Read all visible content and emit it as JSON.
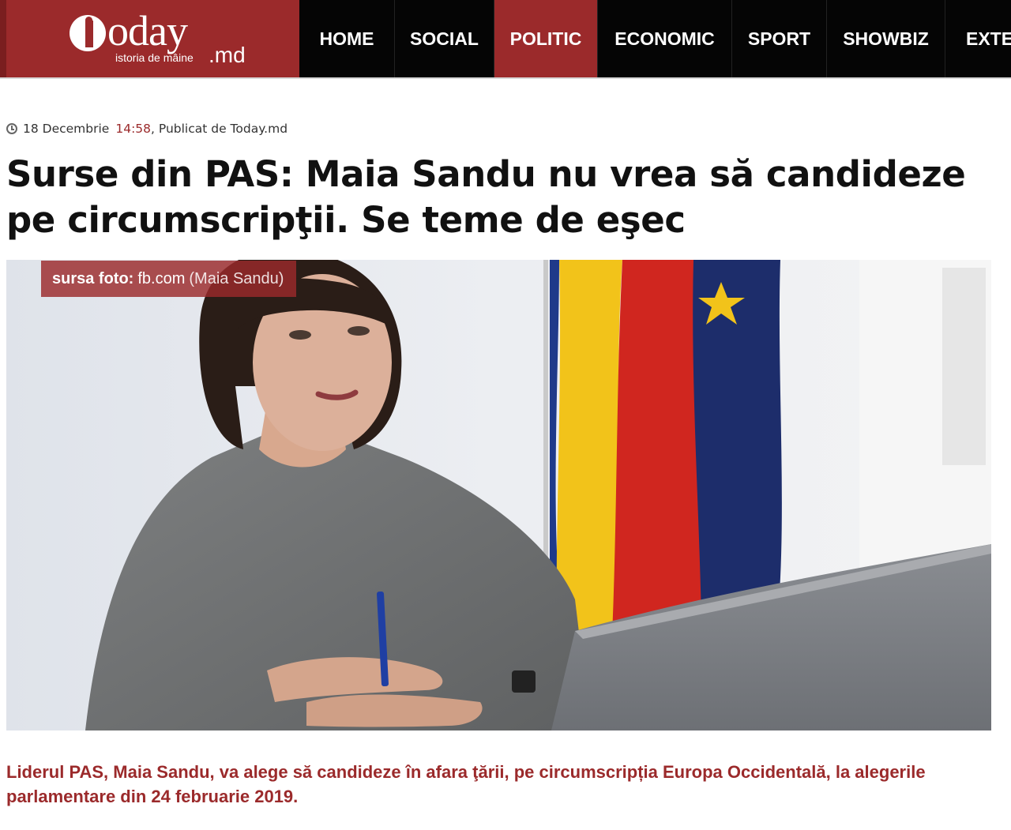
{
  "site": {
    "logo_text": "today",
    "logo_tagline": "istoria de mâine",
    "logo_tld": ".md"
  },
  "nav": {
    "items": [
      {
        "label": "HOME",
        "active": false
      },
      {
        "label": "SOCIAL",
        "active": false
      },
      {
        "label": "POLITIC",
        "active": true
      },
      {
        "label": "ECONOMIC",
        "active": false
      },
      {
        "label": "SPORT",
        "active": false
      },
      {
        "label": "SHOWBIZ",
        "active": false
      },
      {
        "label": "EXTER",
        "active": false
      }
    ]
  },
  "article": {
    "date": "18 Decembrie",
    "time": "14:58",
    "byline": ", Publicat de Today.md",
    "title": "Surse din PAS: Maia Sandu nu vrea să candideze pe circumscripţii. Se teme de eşec",
    "photo_credit_label": "sursa foto:",
    "photo_credit_source": "fb.com",
    "photo_credit_person": "(Maia Sandu)",
    "lead": "Liderul PAS, Maia Sandu, va alege să candideze în afara ţării, pe circumscripția Europa Occidentală, la alegerile parlamentare din 24 februarie 2019."
  },
  "colors": {
    "brand": "#9b2a2b",
    "nav_background": "#050505",
    "text": "#111111"
  },
  "icons": {
    "meta": "clock-icon"
  }
}
